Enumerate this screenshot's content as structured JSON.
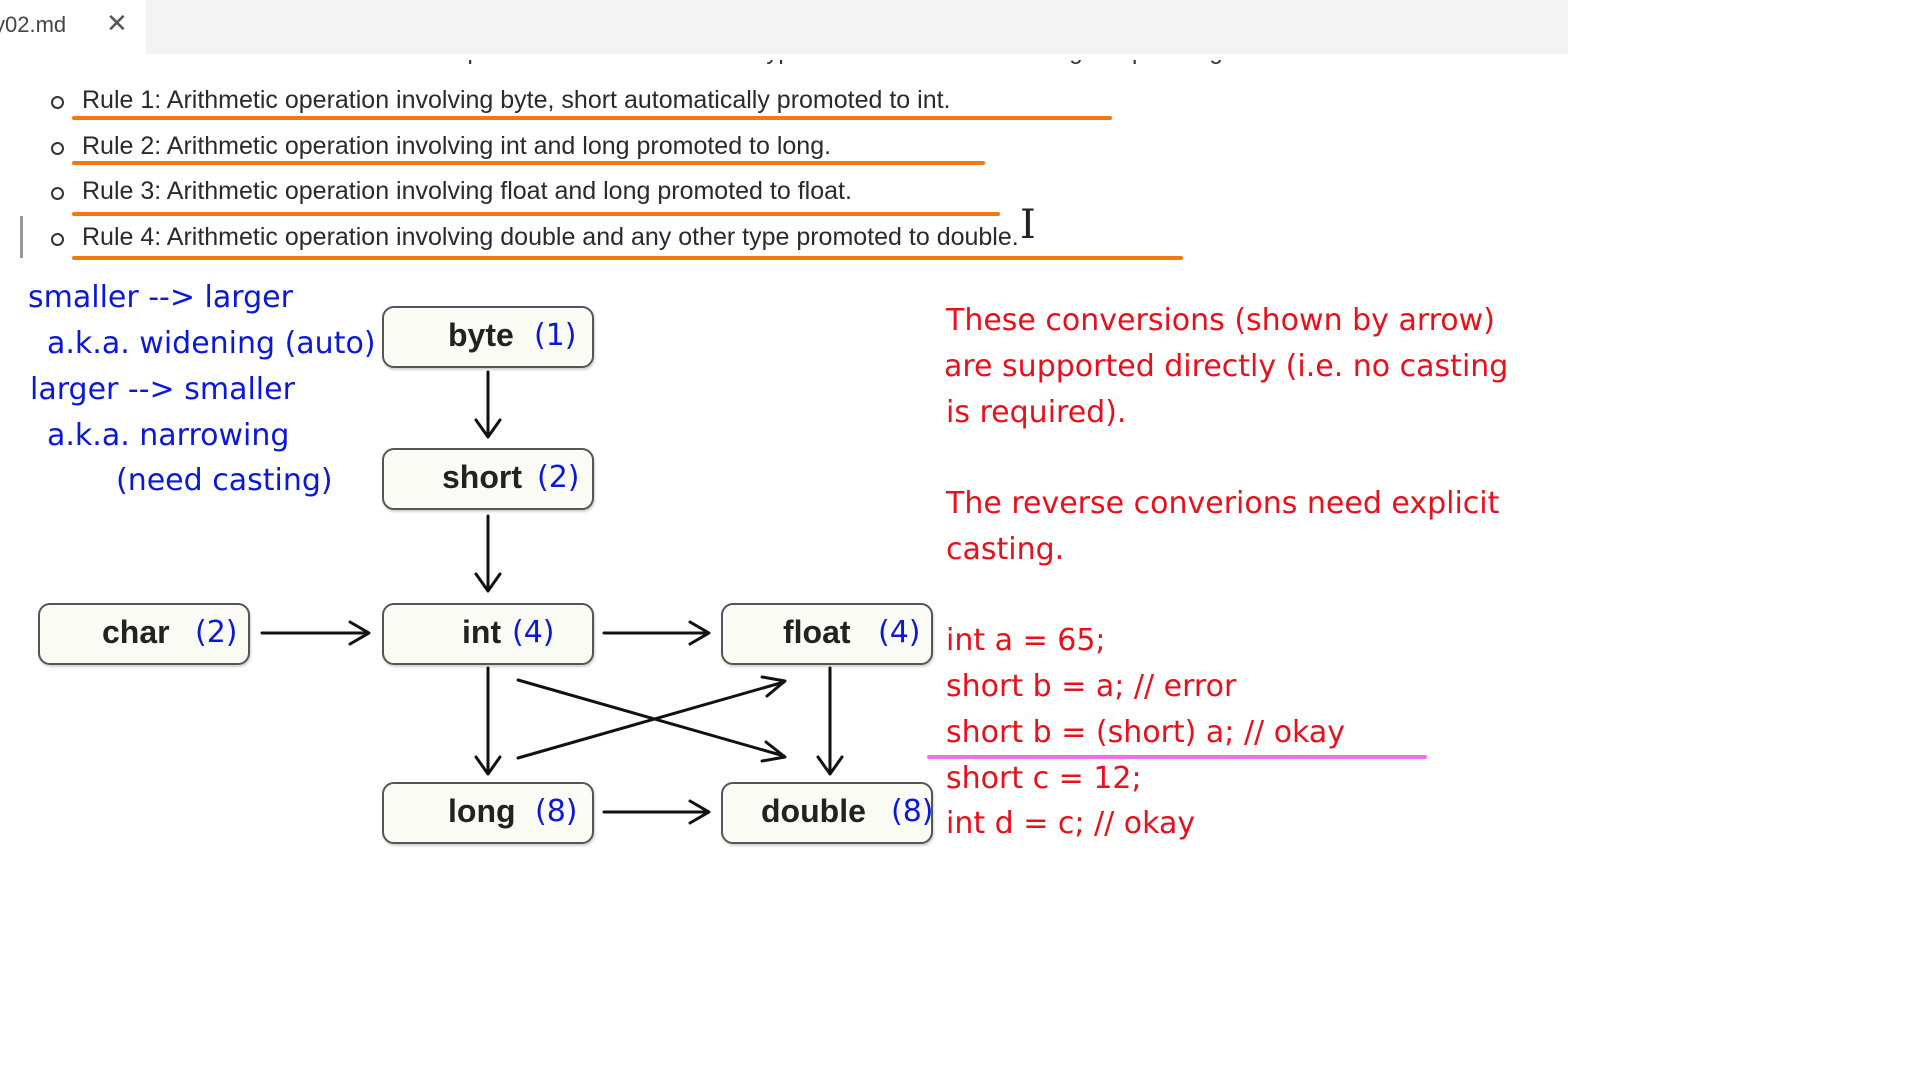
{
  "tab": {
    "label": "y02.md",
    "close_icon": "close-icon"
  },
  "partial_line": "source and destination must be compatible i.e. destination data type must be able to store larger/equal magnitude of",
  "rules": [
    "Rule 1: Arithmetic operation involving byte, short automatically promoted to int.",
    "Rule 2: Arithmetic operation involving int and long promoted to long.",
    "Rule 3: Arithmetic operation involving float and long promoted to float.",
    "Rule 4: Arithmetic operation involving double and any other type promoted to double."
  ],
  "notes_left": [
    "smaller --> larger",
    "a.k.a. widening (auto)",
    "larger --> smaller",
    "a.k.a. narrowing",
    "(need casting)"
  ],
  "diagram": {
    "byte": {
      "name": "byte",
      "size": "(1)"
    },
    "short": {
      "name": "short",
      "size": "(2)"
    },
    "char": {
      "name": "char",
      "size": "(2)"
    },
    "int": {
      "name": "int",
      "size": "(4)"
    },
    "float": {
      "name": "float",
      "size": "(4)"
    },
    "long": {
      "name": "long",
      "size": "(8)"
    },
    "double": {
      "name": "double",
      "size": "(8)"
    }
  },
  "notes_right": [
    "These conversions (shown by arrow)",
    "are supported directly (i.e. no casting",
    "is required).",
    "The reverse converions need explicit",
    "casting."
  ],
  "code_lines": [
    "int a = 65;",
    "short b = a; // error",
    "short b = (short) a; // okay",
    "short c = 12;",
    "int d = c; // okay"
  ],
  "colors": {
    "underline": "#f07a10",
    "ink_blue": "#0a18d8",
    "ink_red": "#e8101a",
    "highlight_pink": "#f06ef0"
  }
}
